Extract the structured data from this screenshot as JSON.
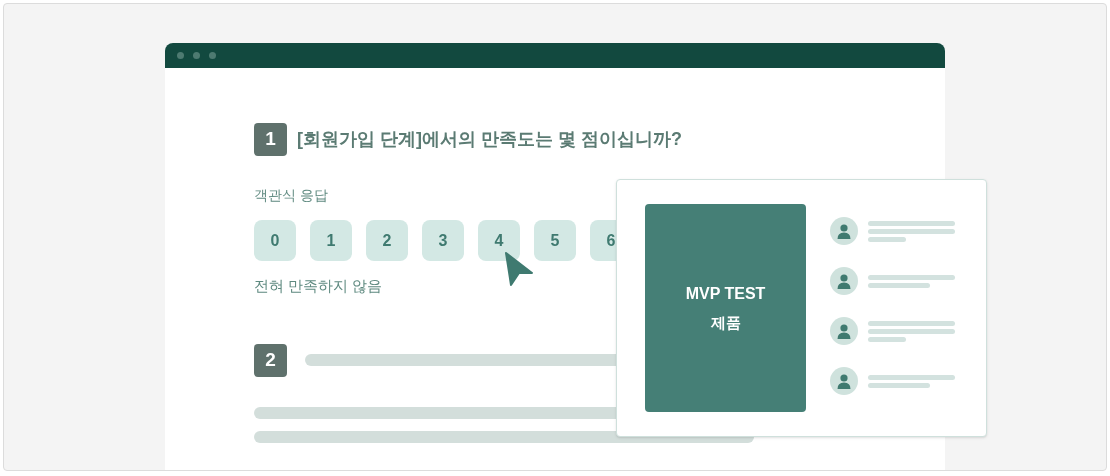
{
  "questions": [
    {
      "kind": "choice",
      "number": "1",
      "title": "[회원가입 단계]에서의 만족도는 몇 점이십니까?",
      "response_label": "객관식 응답",
      "options": [
        "0",
        "1",
        "2",
        "3",
        "4",
        "5",
        "6"
      ],
      "scale_label": "전혀 만족하지 않음"
    },
    {
      "kind": "placeholder",
      "number": "2"
    }
  ],
  "product_card": {
    "title": "MVP TEST",
    "subtitle": "제품",
    "reviewers": [
      {
        "kind": "three-line"
      },
      {
        "kind": "two-line"
      },
      {
        "kind": "three-line"
      },
      {
        "kind": "two-line"
      }
    ]
  }
}
